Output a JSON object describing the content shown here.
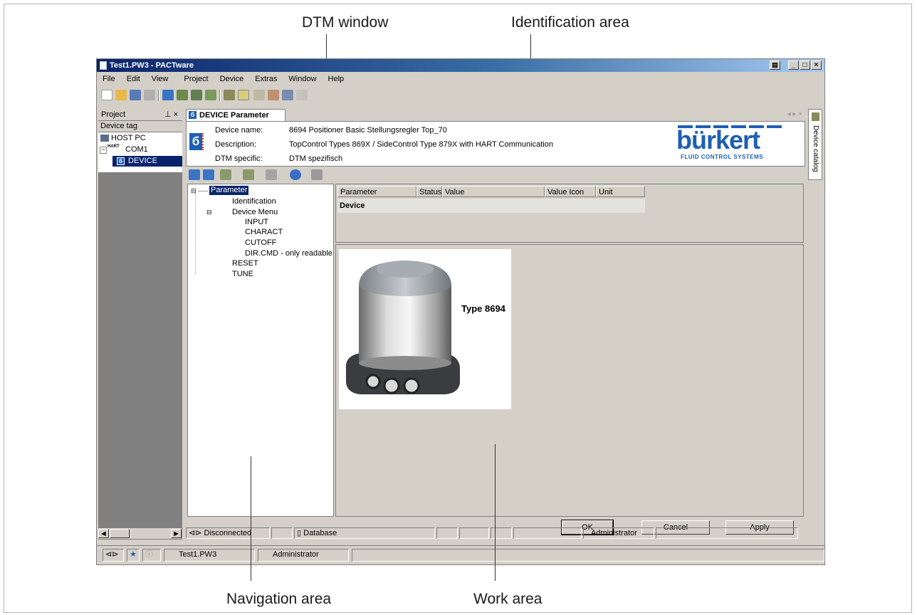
{
  "callouts": {
    "dtm_window": "DTM window",
    "identification_area": "Identification area",
    "navigation_area": "Navigation area",
    "work_area": "Work area"
  },
  "window": {
    "title": "Test1.PW3 - PACTware"
  },
  "menu": [
    "File",
    "Edit",
    "View",
    "Project",
    "Device",
    "Extras",
    "Window",
    "Help"
  ],
  "project_panel": {
    "title": "Project",
    "column_header": "Device tag",
    "items": [
      "HOST PC",
      "COM1",
      "DEVICE"
    ],
    "com_badge": "HART"
  },
  "dtm": {
    "tab_label": "DEVICE Parameter",
    "tab_icon": "б",
    "identification": {
      "labels": [
        "Device name:",
        "Description:",
        "DTM specific:"
      ],
      "values": [
        "8694 Positioner Basic Stellungsregler Top_70",
        "TopControl Types 869X / SideControl Type 879X  with HART Communication",
        "DTM spezifisch"
      ]
    },
    "logo": {
      "brand": "bürkert",
      "tagline": "FLUID CONTROL SYSTEMS"
    },
    "nav_tree": [
      "Parameter",
      "Identification",
      "Device Menu",
      "INPUT",
      "CHARACT",
      "CUTOFF",
      "DIR.CMD - only readable",
      "RESET",
      "TUNE"
    ],
    "grid_columns": [
      "Parameter",
      "Status",
      "Value",
      "Value Icon",
      "Unit"
    ],
    "grid_row": "Device",
    "product_label": "Type 8694",
    "buttons": {
      "ok": "OK",
      "cancel": "Cancel",
      "apply": "Apply"
    },
    "catalog_tab": "Device catalog"
  },
  "status_bar": {
    "connection": "Disconnected",
    "database": "Database",
    "user": "Administrator"
  },
  "bottom_bar": {
    "project_file": "Test1.PW3",
    "user": "Administrator"
  },
  "colors": {
    "title_start": "#0a246a",
    "title_end": "#a6caf0",
    "selection": "#0a246a",
    "brand_blue": "#1e5fb4"
  }
}
